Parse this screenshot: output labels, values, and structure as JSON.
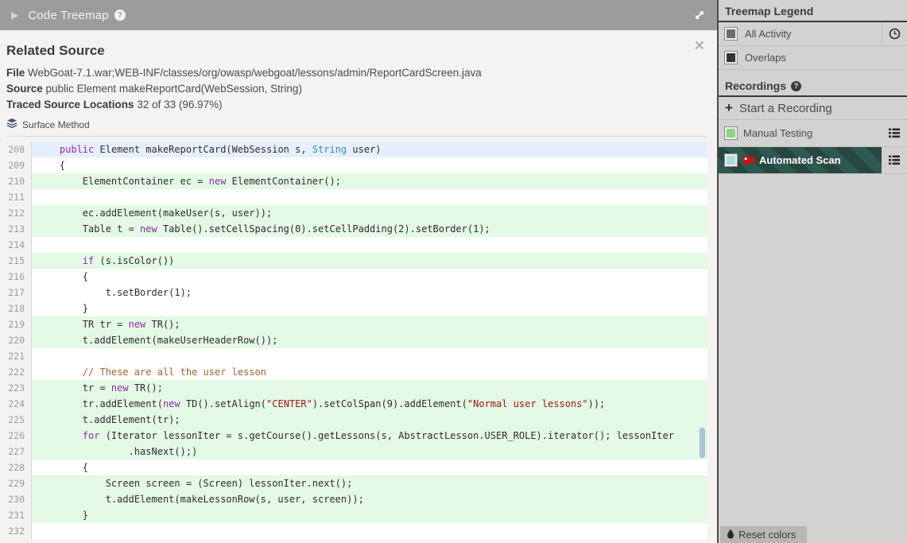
{
  "header": {
    "title": "Code Treemap",
    "help_glyph": "?"
  },
  "related_source": {
    "title": "Related Source",
    "file_label": "File",
    "file_value": "WebGoat-7.1.war;WEB-INF/classes/org/owasp/webgoat/lessons/admin/ReportCardScreen.java",
    "source_label": "Source",
    "source_value": "public Element makeReportCard(WebSession, String)",
    "traced_label": "Traced Source Locations",
    "traced_value": "32 of 33 (96.97%)",
    "surface_method_label": "Surface Method"
  },
  "code": {
    "lines": [
      {
        "num": 208,
        "hl": "blue",
        "tokens": [
          {
            "t": "p",
            "v": "    "
          },
          {
            "t": "k",
            "v": "public"
          },
          {
            "t": "p",
            "v": " Element makeReportCard(WebSession s, "
          },
          {
            "t": "t",
            "v": "String"
          },
          {
            "t": "p",
            "v": " user)"
          }
        ]
      },
      {
        "num": 209,
        "hl": "none",
        "tokens": [
          {
            "t": "p",
            "v": "    {"
          }
        ]
      },
      {
        "num": 210,
        "hl": "green",
        "tokens": [
          {
            "t": "p",
            "v": "        ElementContainer ec = "
          },
          {
            "t": "k",
            "v": "new"
          },
          {
            "t": "p",
            "v": " ElementContainer();"
          }
        ]
      },
      {
        "num": 211,
        "hl": "none",
        "tokens": []
      },
      {
        "num": 212,
        "hl": "green",
        "tokens": [
          {
            "t": "p",
            "v": "        ec.addElement(makeUser(s, user));"
          }
        ]
      },
      {
        "num": 213,
        "hl": "green",
        "tokens": [
          {
            "t": "p",
            "v": "        Table t = "
          },
          {
            "t": "k",
            "v": "new"
          },
          {
            "t": "p",
            "v": " Table().setCellSpacing(0).setCellPadding(2).setBorder(1);"
          }
        ]
      },
      {
        "num": 214,
        "hl": "none",
        "tokens": []
      },
      {
        "num": 215,
        "hl": "green",
        "tokens": [
          {
            "t": "p",
            "v": "        "
          },
          {
            "t": "k",
            "v": "if"
          },
          {
            "t": "p",
            "v": " (s.isColor())"
          }
        ]
      },
      {
        "num": 216,
        "hl": "none",
        "tokens": [
          {
            "t": "p",
            "v": "        {"
          }
        ]
      },
      {
        "num": 217,
        "hl": "none",
        "tokens": [
          {
            "t": "p",
            "v": "            t.setBorder(1);"
          }
        ]
      },
      {
        "num": 218,
        "hl": "none",
        "tokens": [
          {
            "t": "p",
            "v": "        }"
          }
        ]
      },
      {
        "num": 219,
        "hl": "green",
        "tokens": [
          {
            "t": "p",
            "v": "        TR tr = "
          },
          {
            "t": "k",
            "v": "new"
          },
          {
            "t": "p",
            "v": " TR();"
          }
        ]
      },
      {
        "num": 220,
        "hl": "green",
        "tokens": [
          {
            "t": "p",
            "v": "        t.addElement(makeUserHeaderRow());"
          }
        ]
      },
      {
        "num": 221,
        "hl": "none",
        "tokens": []
      },
      {
        "num": 222,
        "hl": "none",
        "tokens": [
          {
            "t": "c",
            "v": "        // These are all the user lesson"
          }
        ]
      },
      {
        "num": 223,
        "hl": "green",
        "tokens": [
          {
            "t": "p",
            "v": "        tr = "
          },
          {
            "t": "k",
            "v": "new"
          },
          {
            "t": "p",
            "v": " TR();"
          }
        ]
      },
      {
        "num": 224,
        "hl": "green",
        "tokens": [
          {
            "t": "p",
            "v": "        tr.addElement("
          },
          {
            "t": "k",
            "v": "new"
          },
          {
            "t": "p",
            "v": " TD().setAlign("
          },
          {
            "t": "s",
            "v": "\"CENTER\""
          },
          {
            "t": "p",
            "v": ").setColSpan(9).addElement("
          },
          {
            "t": "s",
            "v": "\"Normal user lessons\""
          },
          {
            "t": "p",
            "v": "));"
          }
        ]
      },
      {
        "num": 225,
        "hl": "green",
        "tokens": [
          {
            "t": "p",
            "v": "        t.addElement(tr);"
          }
        ]
      },
      {
        "num": 226,
        "hl": "green",
        "tokens": [
          {
            "t": "p",
            "v": "        "
          },
          {
            "t": "k",
            "v": "for"
          },
          {
            "t": "p",
            "v": " (Iterator lessonIter = s.getCourse().getLessons(s, AbstractLesson.USER_ROLE).iterator(); lessonIter"
          }
        ]
      },
      {
        "num": 227,
        "hl": "green",
        "tokens": [
          {
            "t": "p",
            "v": "                .hasNext();)"
          }
        ]
      },
      {
        "num": 228,
        "hl": "none",
        "tokens": [
          {
            "t": "p",
            "v": "        {"
          }
        ]
      },
      {
        "num": 229,
        "hl": "green",
        "tokens": [
          {
            "t": "p",
            "v": "            Screen screen = (Screen) lessonIter.next();"
          }
        ]
      },
      {
        "num": 230,
        "hl": "green",
        "tokens": [
          {
            "t": "p",
            "v": "            t.addElement(makeLessonRow(s, user, screen));"
          }
        ]
      },
      {
        "num": 231,
        "hl": "green",
        "tokens": [
          {
            "t": "p",
            "v": "        }"
          }
        ]
      },
      {
        "num": 232,
        "hl": "none",
        "tokens": []
      }
    ]
  },
  "sidebar": {
    "legend": {
      "title": "Treemap Legend",
      "items": [
        {
          "label": "All Activity",
          "swatch": "#6d6d6d",
          "trailing_icon": "history-clock-icon"
        },
        {
          "label": "Overlaps",
          "swatch": "#333333"
        }
      ]
    },
    "recordings": {
      "title": "Recordings",
      "help_glyph": "?",
      "start_label": "Start a Recording",
      "items": [
        {
          "label": "Manual Testing",
          "swatch": "#8fd185",
          "selected": false
        },
        {
          "label": "Automated Scan",
          "swatch": "#a6dedb",
          "selected": true,
          "icon": "recording-camera-icon"
        }
      ]
    },
    "reset_button": {
      "label": "Reset colors"
    }
  },
  "colors": {
    "panel_header_bg": "#9c9c9a",
    "traced_line_highlight": "#e3f8e5",
    "selected_line_highlight": "#e7effc",
    "syntax_keyword": "#8b2fa8",
    "syntax_type": "#2b91af",
    "syntax_string": "#a31515",
    "syntax_comment": "#a5632d",
    "selected_recording_bg": "#2e5950",
    "selected_recording_stripe": "#27483f",
    "sidebar_bg": "#d4d2d0"
  }
}
